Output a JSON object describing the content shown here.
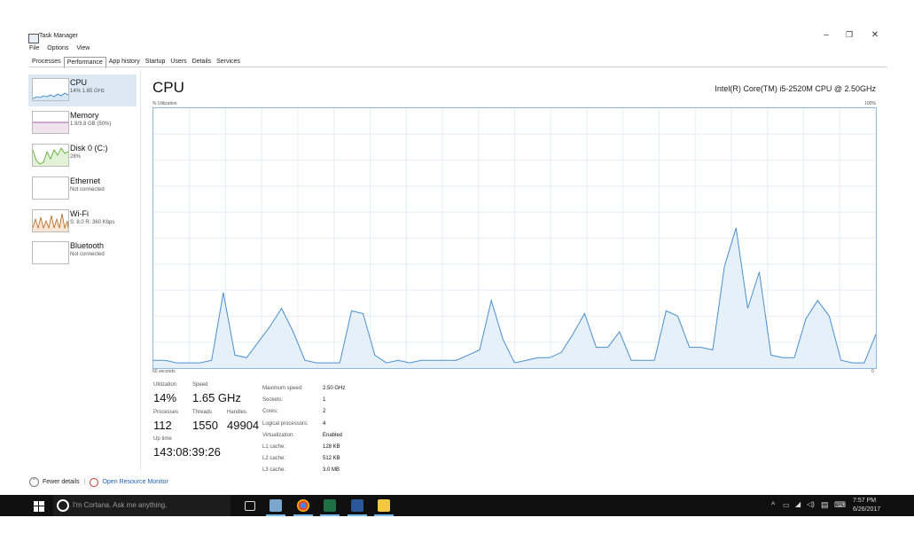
{
  "window": {
    "title": "Task Manager",
    "minimize": "–",
    "maximize": "❐",
    "close": "✕"
  },
  "menu": [
    "File",
    "Options",
    "View"
  ],
  "tabs": [
    "Processes",
    "Performance",
    "App history",
    "Startup",
    "Users",
    "Details",
    "Services"
  ],
  "active_tab": "Performance",
  "sidebar": [
    {
      "name": "CPU",
      "sub": "14% 1.65 GHz",
      "color": "#2b7cc4",
      "fill": "#d6e7f6"
    },
    {
      "name": "Memory",
      "sub": "1.9/3.8 GB (50%)",
      "color": "#8b2a7e",
      "fill": "#f1e3ee"
    },
    {
      "name": "Disk 0 (C:)",
      "sub": "28%",
      "color": "#4ea51f",
      "fill": "#e1f2d6"
    },
    {
      "name": "Ethernet",
      "sub": "Not connected",
      "color": "#b0b0b0",
      "fill": "#ffffff"
    },
    {
      "name": "Wi-Fi",
      "sub": "S: 8.0 R: 360 Kbps",
      "color": "#b6651c",
      "fill": "#f7e6d5"
    },
    {
      "name": "Bluetooth",
      "sub": "Not connected",
      "color": "#b0b0b0",
      "fill": "#ffffff"
    }
  ],
  "main": {
    "title": "CPU",
    "model": "Intel(R) Core(TM) i5-2520M CPU @ 2.50GHz",
    "util_label": "% Utilization",
    "max_label": "100%",
    "time_label": "60 seconds",
    "min_label": "0"
  },
  "chart_data": {
    "type": "area",
    "title": "CPU",
    "ylabel": "% Utilization",
    "xlabel": "60 seconds",
    "ylim": [
      0,
      100
    ],
    "values": [
      3,
      3,
      2,
      2,
      2,
      3,
      29,
      5,
      4,
      10,
      16,
      23,
      14,
      3,
      2,
      2,
      2,
      22,
      21,
      5,
      2,
      3,
      2,
      3,
      3,
      3,
      3,
      5,
      7,
      26,
      11,
      2,
      3,
      4,
      4,
      6,
      13,
      21,
      8,
      8,
      14,
      3,
      3,
      3,
      22,
      20,
      8,
      8,
      7,
      39,
      54,
      23,
      37,
      5,
      4,
      4,
      19,
      26,
      20,
      3,
      2,
      2,
      13
    ],
    "color": "#4a8fcf",
    "fill": "#e6f0f9",
    "grid": true
  },
  "stats": {
    "utilization_label": "Utilization",
    "utilization": "14%",
    "speed_label": "Speed",
    "speed": "1.65 GHz",
    "processes_label": "Processes",
    "processes": "112",
    "threads_label": "Threads",
    "threads": "1550",
    "handles_label": "Handles",
    "handles": "49904",
    "uptime_label": "Up time",
    "uptime": "143:08:39:26"
  },
  "specs": [
    {
      "label": "Maximum speed:",
      "value": "2.50 GHz"
    },
    {
      "label": "Sockets:",
      "value": "1"
    },
    {
      "label": "Cores:",
      "value": "2"
    },
    {
      "label": "Logical processors:",
      "value": "4"
    },
    {
      "label": "Virtualization:",
      "value": "Enabled"
    },
    {
      "label": "L1 cache:",
      "value": "128 KB"
    },
    {
      "label": "L2 cache:",
      "value": "512 KB"
    },
    {
      "label": "L3 cache:",
      "value": "3.0 MB"
    }
  ],
  "footer": {
    "fewer_details": "Fewer details",
    "separator": "|",
    "open_monitor": "Open Resource Monitor"
  },
  "taskbar": {
    "search_placeholder": "I'm Cortana. Ask me anything.",
    "time": "7:57 PM",
    "date": "6/26/2017"
  }
}
